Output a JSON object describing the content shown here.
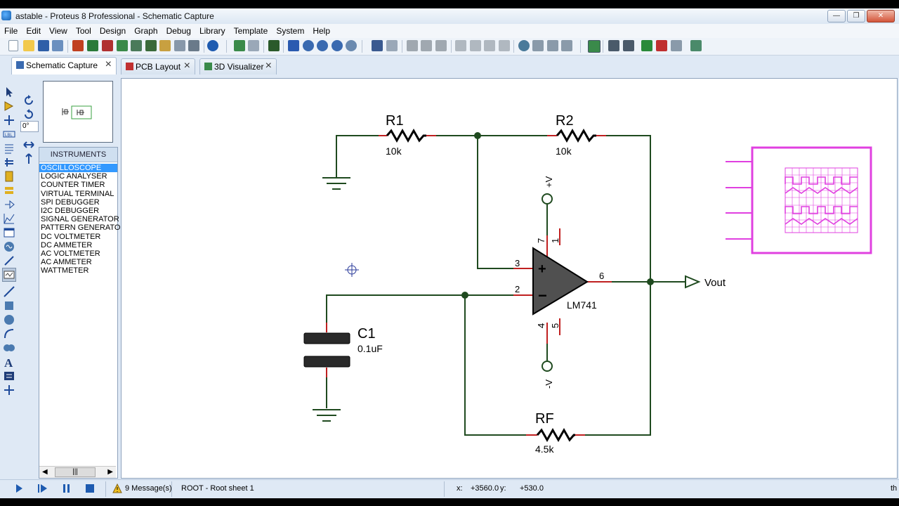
{
  "window": {
    "title": "astable - Proteus 8 Professional - Schematic Capture"
  },
  "menu": [
    "File",
    "Edit",
    "View",
    "Tool",
    "Design",
    "Graph",
    "Debug",
    "Library",
    "Template",
    "System",
    "Help"
  ],
  "tabs": [
    {
      "label": "Schematic Capture",
      "active": true
    },
    {
      "label": "PCB Layout",
      "active": false
    },
    {
      "label": "3D Visualizer",
      "active": false
    }
  ],
  "rotation": {
    "value": "0°"
  },
  "instruments": {
    "header": "INSTRUMENTS",
    "items": [
      "OSCILLOSCOPE",
      "LOGIC ANALYSER",
      "COUNTER TIMER",
      "VIRTUAL TERMINAL",
      "SPI DEBUGGER",
      "I2C DEBUGGER",
      "SIGNAL GENERATOR",
      "PATTERN GENERATO",
      "DC VOLTMETER",
      "DC AMMETER",
      "AC VOLTMETER",
      "AC AMMETER",
      "WATTMETER"
    ],
    "selected": "OSCILLOSCOPE",
    "scroll_thumb": "|||"
  },
  "schematic": {
    "r1": {
      "ref": "R1",
      "value": "10k"
    },
    "r2": {
      "ref": "R2",
      "value": "10k"
    },
    "rf": {
      "ref": "RF",
      "value": "4.5k"
    },
    "c1": {
      "ref": "C1",
      "value": "0.1uF"
    },
    "opamp": {
      "part": "LM741",
      "pin3": "3",
      "pin2": "2",
      "pin6": "6",
      "pin7": "7",
      "pin4": "4",
      "pin1": "1",
      "pin5": "5",
      "plus": "+",
      "minus": "−"
    },
    "vplus": "+V",
    "vminus": "-V",
    "vout": "Vout",
    "wire_color": "#1f4a1f",
    "oscilloscope_color": "#e040e0"
  },
  "status": {
    "messages": "9 Message(s)",
    "sheet": "ROOT - Root sheet 1",
    "x_label": "x:",
    "x_value": "+3560.0",
    "y_label": "y:",
    "y_value": "+530.0",
    "right_text": "th"
  }
}
